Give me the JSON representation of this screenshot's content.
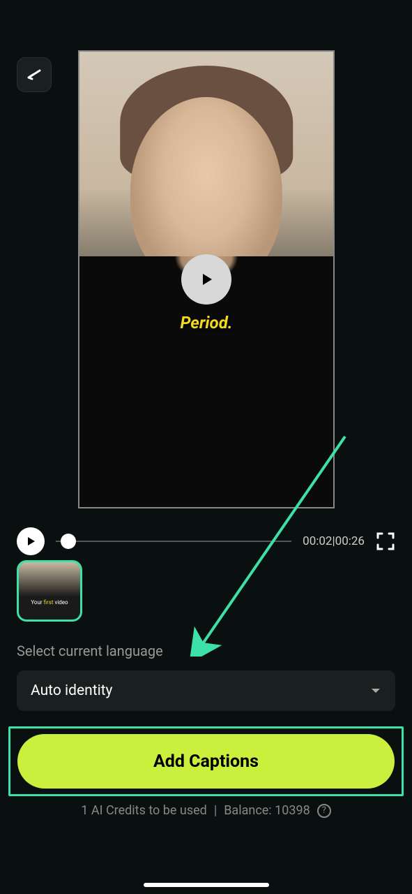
{
  "video": {
    "caption_text": "Period.",
    "current_time": "00:02",
    "total_time": "00:26"
  },
  "thumbnail": {
    "caption_prefix": "Your ",
    "caption_highlight": "first",
    "caption_suffix": " video"
  },
  "language": {
    "label": "Select current language",
    "selected": "Auto identity"
  },
  "action": {
    "button_label": "Add Captions"
  },
  "credits": {
    "usage_text": "1 AI Credits to be used",
    "separator": "|",
    "balance_text": "Balance: 10398"
  }
}
